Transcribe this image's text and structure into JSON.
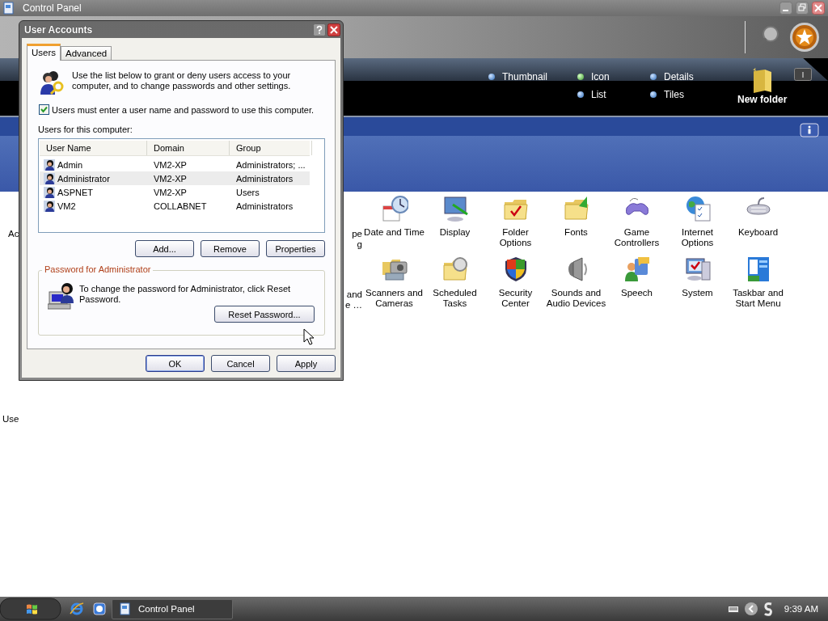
{
  "window": {
    "title": "Control Panel"
  },
  "view_options": [
    {
      "label": "Thumbnail",
      "selected": false
    },
    {
      "label": "Icon",
      "selected": true
    },
    {
      "label": "Details",
      "selected": false
    },
    {
      "label": "List",
      "selected": false
    },
    {
      "label": "Tiles",
      "selected": false
    }
  ],
  "new_folder": {
    "label": "New folder"
  },
  "items": [
    {
      "label": "Ac",
      "kind": "cut_end"
    },
    {
      "label": "pe\ng",
      "kind": "cut_start"
    },
    {
      "label": "Date and Time",
      "kind": "full"
    },
    {
      "label": "Display",
      "kind": "full"
    },
    {
      "label": "Folder Options",
      "kind": "full"
    },
    {
      "label": "Fonts",
      "kind": "full"
    },
    {
      "label": "Game Controllers",
      "kind": "full"
    },
    {
      "label": "Internet Options",
      "kind": "full"
    },
    {
      "label": "Keyboard",
      "kind": "full"
    },
    {
      "label": "and\ne …",
      "kind": "cut_start"
    },
    {
      "label": "Scanners and Cameras",
      "kind": "full"
    },
    {
      "label": "Scheduled Tasks",
      "kind": "full"
    },
    {
      "label": "Security Center",
      "kind": "full"
    },
    {
      "label": "Sounds and Audio Devices",
      "kind": "full"
    },
    {
      "label": "Speech",
      "kind": "full"
    },
    {
      "label": "System",
      "kind": "full"
    },
    {
      "label": "Taskbar and Start Menu",
      "kind": "full"
    },
    {
      "label": "Use",
      "kind": "cut_end"
    }
  ],
  "dialog": {
    "title": "User Accounts",
    "tabs": [
      {
        "label": "Users",
        "selected": true
      },
      {
        "label": "Advanced",
        "selected": false
      }
    ],
    "intro": "Use the list below to grant or deny users access to your computer, and to change passwords and other settings.",
    "require_login": {
      "label": "Users must enter a user name and password to use this computer.",
      "checked": true
    },
    "list_label": "Users for this computer:",
    "columns": [
      "User Name",
      "Domain",
      "Group"
    ],
    "rows": [
      {
        "cells": [
          "Admin",
          "VM2-XP",
          "Administrators; ..."
        ],
        "selected": false
      },
      {
        "cells": [
          "Administrator",
          "VM2-XP",
          "Administrators"
        ],
        "selected": true
      },
      {
        "cells": [
          "ASPNET",
          "VM2-XP",
          "Users"
        ],
        "selected": false
      },
      {
        "cells": [
          "VM2",
          "COLLABNET",
          "Administrators"
        ],
        "selected": false
      }
    ],
    "list_buttons": [
      "Add...",
      "Remove",
      "Properties"
    ],
    "password_group": {
      "title": "Password for Administrator",
      "text": "To change the password for Administrator, click Reset Password.",
      "button": "Reset Password..."
    },
    "buttons": [
      "OK",
      "Cancel",
      "Apply"
    ]
  },
  "taskbar": {
    "tasks": [
      {
        "label": "Control Panel"
      }
    ],
    "clock": "9:39 AM"
  }
}
